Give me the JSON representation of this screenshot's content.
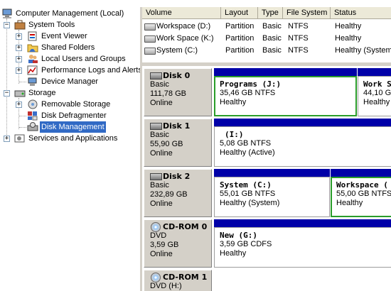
{
  "tree": {
    "root": "Computer Management (Local)",
    "system_tools": "System Tools",
    "event_viewer": "Event Viewer",
    "shared_folders": "Shared Folders",
    "local_users": "Local Users and Groups",
    "perf_logs": "Performance Logs and Alerts",
    "device_manager": "Device Manager",
    "storage": "Storage",
    "removable_storage": "Removable Storage",
    "disk_defrag": "Disk Defragmenter",
    "disk_management": "Disk Management",
    "services_apps": "Services and Applications",
    "expander_plus": "+",
    "expander_minus": "−"
  },
  "columns": {
    "volume": "Volume",
    "layout": "Layout",
    "type": "Type",
    "fs": "File System",
    "status": "Status"
  },
  "volumes": [
    {
      "name": "Workspace (D:)",
      "layout": "Partition",
      "type": "Basic",
      "fs": "NTFS",
      "status": "Healthy"
    },
    {
      "name": "Work Space (K:)",
      "layout": "Partition",
      "type": "Basic",
      "fs": "NTFS",
      "status": "Healthy"
    },
    {
      "name": "System (C:)",
      "layout": "Partition",
      "type": "Basic",
      "fs": "NTFS",
      "status": "Healthy (System"
    }
  ],
  "disks": [
    {
      "name": "Disk 0",
      "kind": "Basic",
      "size": "111,78 GB",
      "status": "Online"
    },
    {
      "name": "Disk 1",
      "kind": "Basic",
      "size": "55,90 GB",
      "status": "Online"
    },
    {
      "name": "Disk 2",
      "kind": "Basic",
      "size": "232,89 GB",
      "status": "Online"
    },
    {
      "name": "CD-ROM 0",
      "kind": "DVD",
      "size": "3,59 GB",
      "status": "Online"
    },
    {
      "name": "CD-ROM 1",
      "kind": "DVD (H:)"
    }
  ],
  "partitions": {
    "programs": {
      "name": "Programs (J:)",
      "size": "35,46 GB NTFS",
      "status": "Healthy"
    },
    "workspace_k": {
      "name": "Work S",
      "size": "44,10 G",
      "status": "Healthy"
    },
    "disk1_i": {
      "name": "(I:)",
      "size": "5,08 GB NTFS",
      "status": "Healthy (Active)"
    },
    "system_c": {
      "name": "System (C:)",
      "size": "55,01 GB NTFS",
      "status": "Healthy (System)"
    },
    "workspace_d": {
      "name": "Workspace (",
      "size": "55,00 GB NTFS",
      "status": "Healthy"
    },
    "new_g": {
      "name": "New (G:)",
      "size": "3,59 GB CDFS",
      "status": "Healthy"
    }
  },
  "colors": {
    "partition_bar": "#0000a8",
    "selection": "#316ac5",
    "selected_border": "#2a9d2a"
  }
}
